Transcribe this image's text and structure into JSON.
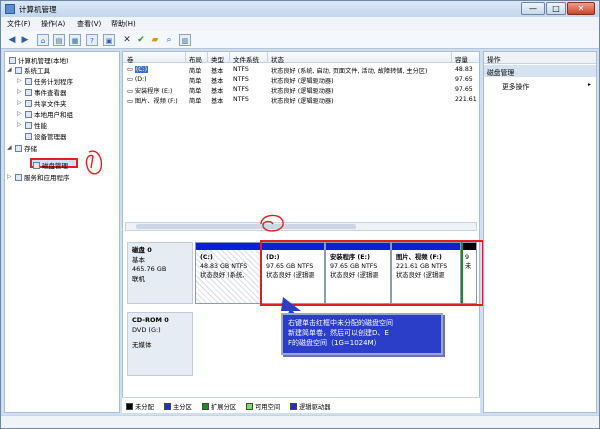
{
  "window": {
    "title": "计算机管理",
    "minimize": "—",
    "maximize": "□",
    "close": "✕"
  },
  "menu": [
    "文件(F)",
    "操作(A)",
    "查看(V)",
    "帮助(H)"
  ],
  "toolbar": {
    "icons": [
      "back-icon",
      "forward-icon",
      "up-folder-icon",
      "show-tree-icon",
      "properties-icon",
      "help-icon",
      "settings-icon",
      "delete-icon",
      "check-icon",
      "folder-icon",
      "search-icon",
      "properties2-icon"
    ]
  },
  "tree": {
    "root": "计算机管理(本地)",
    "system_tools": "系统工具",
    "task_scheduler": "任务计划程序",
    "event_viewer": "事件查看器",
    "shared_folders": "共享文件夹",
    "local_users": "本地用户和组",
    "performance": "性能",
    "device_manager": "设备管理器",
    "storage": "存储",
    "disk_management": "磁盘管理",
    "services": "服务和应用程序"
  },
  "volume_list": {
    "headers": [
      "卷",
      "布局",
      "类型",
      "文件系统",
      "状态",
      "容量"
    ],
    "rows": [
      [
        "(C:)",
        "简单",
        "基本",
        "NTFS",
        "状态良好 (系统, 启动, 页面文件, 活动, 故障转储, 主分区)",
        "48.83"
      ],
      [
        "(D:)",
        "简单",
        "基本",
        "NTFS",
        "状态良好 (逻辑驱动器)",
        "97.65"
      ],
      [
        "安装程序 (E:)",
        "简单",
        "基本",
        "NTFS",
        "状态良好 (逻辑驱动器)",
        "97.65"
      ],
      [
        "图片、视频 (F:)",
        "简单",
        "基本",
        "NTFS",
        "状态良好 (逻辑驱动器)",
        "221.61"
      ]
    ]
  },
  "disk0": {
    "name": "磁盘 0",
    "type": "基本",
    "size": "465.76 GB",
    "status": "联机",
    "partitions": [
      {
        "name": "(C:)",
        "size": "48.83 GB NTFS",
        "status": "状态良好 (系统,"
      },
      {
        "name": "(D:)",
        "size": "97.65 GB NTFS",
        "status": "状态良好 (逻辑驱"
      },
      {
        "name": "安装程序 (E:)",
        "size": "97.65 GB NTFS",
        "status": "状态良好 (逻辑驱"
      },
      {
        "name": "图片、视频 (F:)",
        "size": "221.61 GB NTFS",
        "status": "状态良好 (逻辑驱"
      },
      {
        "name": "",
        "size": "9",
        "status": "未"
      }
    ]
  },
  "cdrom0": {
    "name": "CD-ROM 0",
    "drive": "DVD (G:)",
    "media": "无媒体"
  },
  "callout": {
    "line1": "右键单击红框中未分配的磁盘空间",
    "line2": "新建简单卷，然后可以创建D、E",
    "line3": "F的磁盘空间（1G=1024M）"
  },
  "legend": [
    {
      "label": "未分配",
      "color": "#000000"
    },
    {
      "label": "主分区",
      "color": "#1e2fd0"
    },
    {
      "label": "扩展分区",
      "color": "#1f8a1f"
    },
    {
      "label": "可用空间",
      "color": "#7ddc6a"
    },
    {
      "label": "逻辑驱动器",
      "color": "#1e2fd0"
    }
  ],
  "actions": {
    "header": "操作",
    "section": "磁盘管理",
    "more": "更多操作",
    "more_arrow": "▸"
  }
}
